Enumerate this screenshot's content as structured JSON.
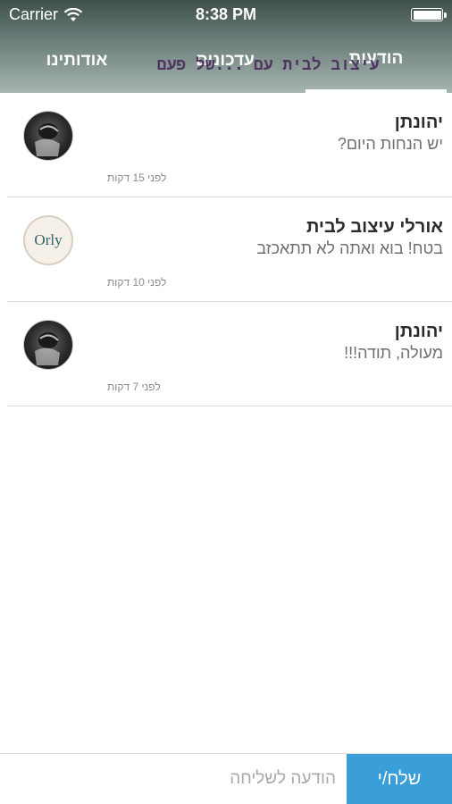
{
  "status_bar": {
    "carrier": "Carrier",
    "time": "8:38 PM",
    "battery_level": 1.0
  },
  "tabs": [
    {
      "label": "הודעות",
      "active": true
    },
    {
      "label": "עדכונים",
      "active": false
    },
    {
      "label": "אודותינו",
      "active": false
    }
  ],
  "brand_overlay": "עיצוב לבית עם ...של פעם",
  "messages": [
    {
      "name": "יהונתן",
      "text": "יש הנחות היום?",
      "time": "לפני 15 דקות",
      "avatar": "dark-profile-photo"
    },
    {
      "name": "אורלי עיצוב לבית",
      "text": "בטח! בוא ואתה לא תתאכזב",
      "time": "לפני 10 דקות",
      "avatar_text": "Orly"
    },
    {
      "name": "יהונתן",
      "text": "מעולה, תודה!!!",
      "time": "לפני 7 דקות",
      "avatar": "dark-profile-photo"
    }
  ],
  "composer": {
    "placeholder": "הודעה לשליחה",
    "send_label": "שלח/י"
  },
  "colors": {
    "header_top": "#3f4f4c",
    "header_bottom": "#a7b5b1",
    "send_button": "#3a9fd8"
  }
}
